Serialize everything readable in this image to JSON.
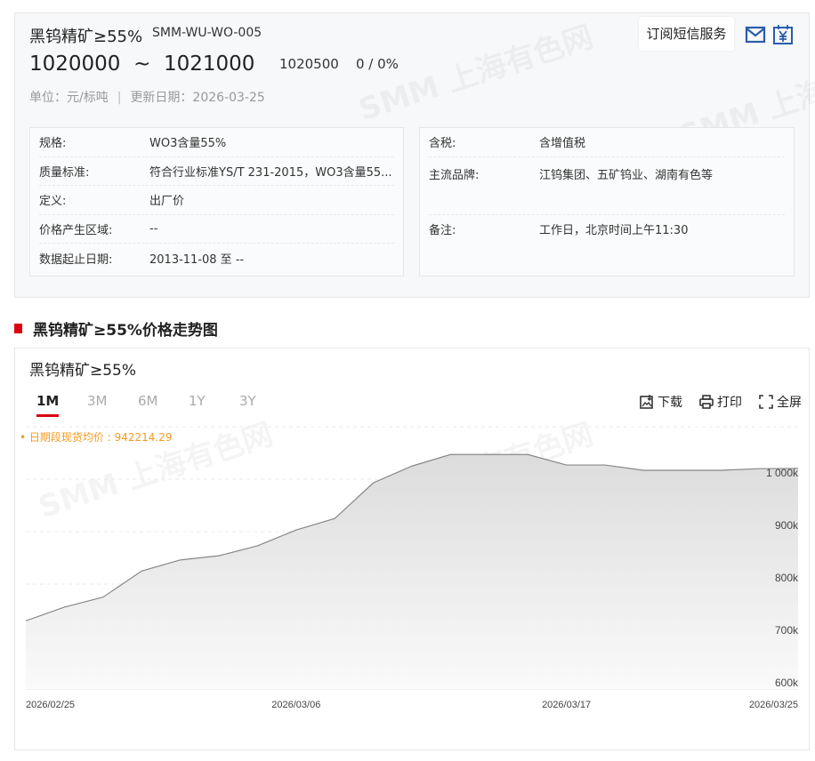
{
  "header": {
    "title": "黑钨精矿≥55%",
    "code": "SMM-WU-WO-005",
    "price_low": "1020000",
    "price_sep": "~",
    "price_high": "1021000",
    "mid_price": "1020500",
    "change": "0 / 0%",
    "unit": "单位：元/标吨",
    "separator": "|",
    "updated": "更新日期：2026-03-25",
    "subscribe_label": "订阅短信服务",
    "accent": "#2a5caa"
  },
  "details_left": [
    {
      "k": "规格:",
      "v": "WO3含量55%"
    },
    {
      "k": "质量标准:",
      "v": "符合行业标准YS/T 231-2015，WO3含量55..."
    },
    {
      "k": "定义:",
      "v": "出厂价"
    },
    {
      "k": "价格产生区域:",
      "v": "--"
    },
    {
      "k": "数据起止日期:",
      "v": "2013-11-08 至 --"
    }
  ],
  "details_right": [
    {
      "k": "含税:",
      "v": "含增值税"
    },
    {
      "k": "主流品牌:",
      "v": "江钨集团、五矿钨业、湖南有色等"
    },
    {
      "k": "备注:",
      "v": "工作日，北京时间上午11:30"
    }
  ],
  "section_title": "黑钨精矿≥55%价格走势图",
  "chart_panel": {
    "name": "黑钨精矿≥55%",
    "tabs": [
      "1M",
      "3M",
      "6M",
      "1Y",
      "3Y"
    ],
    "active_tab": "1M",
    "tools": {
      "download": "下载",
      "print": "打印",
      "fullscreen": "全屏"
    },
    "avg_label": "• 日期段现货均价 : 942214.29"
  },
  "watermark": "SMM 上海有色网",
  "chart_data": {
    "type": "area",
    "title": "黑钨精矿≥55%",
    "x": [
      "2026/02/25",
      "2026/02/26",
      "2026/02/27",
      "2026/03/02",
      "2026/03/03",
      "2026/03/04",
      "2026/03/05",
      "2026/03/06",
      "2026/03/09",
      "2026/03/10",
      "2026/03/11",
      "2026/03/12",
      "2026/03/13",
      "2026/03/16",
      "2026/03/17",
      "2026/03/18",
      "2026/03/19",
      "2026/03/20",
      "2026/03/23",
      "2026/03/24",
      "2026/03/25"
    ],
    "values": [
      730000,
      756000,
      775000,
      825000,
      846000,
      854000,
      873000,
      903000,
      925000,
      993000,
      1025000,
      1047000,
      1047000,
      1047000,
      1027000,
      1027000,
      1017000,
      1017000,
      1017000,
      1020000,
      1020500
    ],
    "x_tick_labels": [
      "2026/02/25",
      "2026/03/06",
      "2026/03/17",
      "2026/03/25"
    ],
    "x_tick_index": [
      0,
      7,
      14,
      20
    ],
    "y_ticks": [
      600000,
      700000,
      800000,
      900000,
      1000000
    ],
    "y_tick_labels": [
      "600k",
      "700k",
      "800k",
      "900k",
      "1 000k"
    ],
    "ylim": [
      600000,
      1100000
    ],
    "grid": true,
    "xlabel": "",
    "ylabel": "",
    "line_color": "#888888"
  }
}
